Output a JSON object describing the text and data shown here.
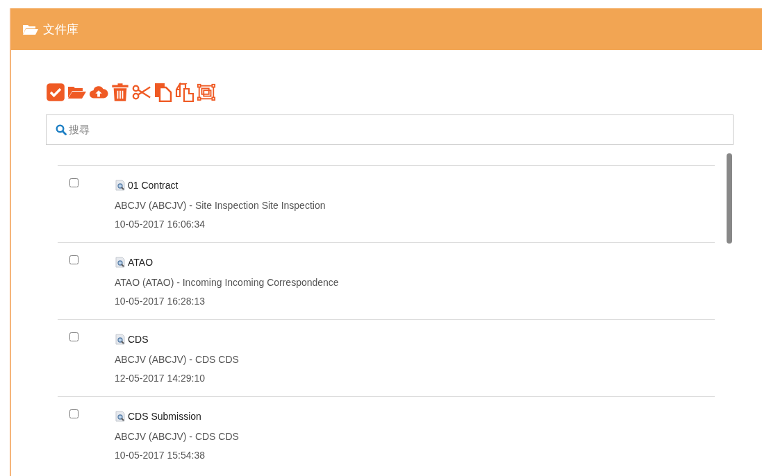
{
  "panel": {
    "title": "文件庫"
  },
  "search": {
    "placeholder": "搜尋"
  },
  "files": [
    {
      "name": "01 Contract",
      "description": "ABCJV (ABCJV) - Site Inspection Site Inspection",
      "date": "10-05-2017 16:06:34",
      "checked": false
    },
    {
      "name": "ATAO",
      "description": "ATAO (ATAO) - Incoming Incoming Correspondence",
      "date": "10-05-2017 16:28:13",
      "checked": false
    },
    {
      "name": "CDS",
      "description": "ABCJV (ABCJV) - CDS CDS",
      "date": "12-05-2017 14:29:10",
      "checked": false
    },
    {
      "name": "CDS Submission",
      "description": "ABCJV (ABCJV) - CDS CDS",
      "date": "10-05-2017 15:54:38",
      "checked": false
    }
  ]
}
